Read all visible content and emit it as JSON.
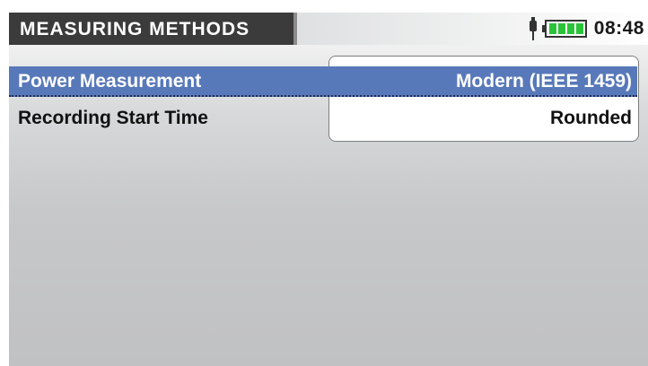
{
  "header": {
    "title": "MEASURING METHODS",
    "time": "08:48",
    "icons": [
      "plug-icon",
      "battery-icon"
    ],
    "battery_level": 1.0
  },
  "settings": [
    {
      "label": "Power Measurement",
      "value": "Modern (IEEE 1459)",
      "selected": true
    },
    {
      "label": "Recording Start Time",
      "value": "Rounded",
      "selected": false
    }
  ],
  "colors": {
    "title_bg": "#3b3b3b",
    "selection_bg": "#5879b9",
    "battery_green": "#2bc33a"
  }
}
